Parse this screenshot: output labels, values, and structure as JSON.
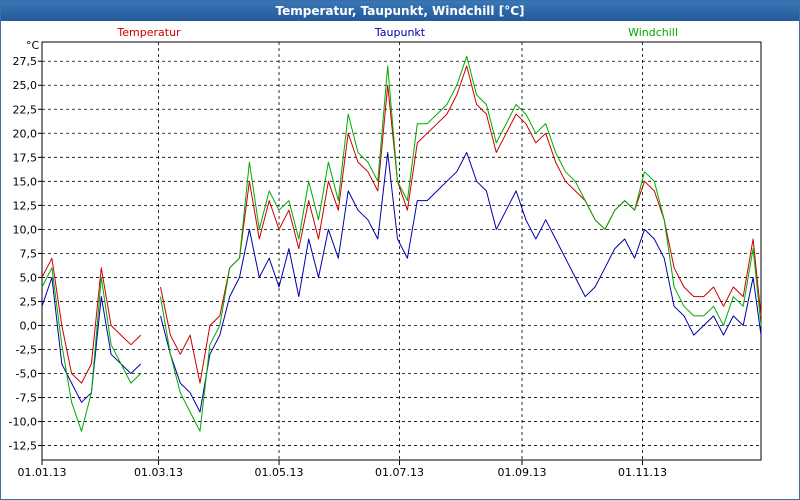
{
  "window": {
    "title": "Temperatur, Taupunkt, Windchill [°C]"
  },
  "chart_data": {
    "type": "line",
    "title": "Temperatur, Taupunkt, Windchill [°C]",
    "yunit": "°C",
    "ylim": [
      -14,
      29.5
    ],
    "yticks": [
      "27,5",
      "25,0",
      "22,5",
      "20,0",
      "17,5",
      "15,0",
      "12,5",
      "10,0",
      "7,5",
      "5,0",
      "2,5",
      "0,0",
      "-2,5",
      "-5,0",
      "-7,5",
      "-10,0",
      "-12,5"
    ],
    "xlim": [
      "2013-01-01",
      "2013-12-31"
    ],
    "xticks": [
      {
        "date": "2013-01-01",
        "label": "01.01.13"
      },
      {
        "date": "2013-03-01",
        "label": "01.03.13"
      },
      {
        "date": "2013-05-01",
        "label": "01.05.13"
      },
      {
        "date": "2013-07-01",
        "label": "01.07.13"
      },
      {
        "date": "2013-09-01",
        "label": "01.09.13"
      },
      {
        "date": "2013-11-01",
        "label": "01.11.13"
      }
    ],
    "grid": true,
    "legend_position": "top",
    "x": [
      "2013-01-01",
      "2013-01-06",
      "2013-01-11",
      "2013-01-16",
      "2013-01-21",
      "2013-01-26",
      "2013-01-31",
      "2013-02-05",
      "2013-02-10",
      "2013-02-15",
      "2013-02-20",
      "2013-02-25",
      "2013-03-02",
      "2013-03-07",
      "2013-03-12",
      "2013-03-17",
      "2013-03-22",
      "2013-03-27",
      "2013-04-01",
      "2013-04-06",
      "2013-04-11",
      "2013-04-16",
      "2013-04-21",
      "2013-04-26",
      "2013-05-01",
      "2013-05-06",
      "2013-05-11",
      "2013-05-16",
      "2013-05-21",
      "2013-05-26",
      "2013-05-31",
      "2013-06-05",
      "2013-06-10",
      "2013-06-15",
      "2013-06-20",
      "2013-06-25",
      "2013-06-30",
      "2013-07-05",
      "2013-07-10",
      "2013-07-15",
      "2013-07-20",
      "2013-07-25",
      "2013-07-30",
      "2013-08-04",
      "2013-08-09",
      "2013-08-14",
      "2013-08-19",
      "2013-08-24",
      "2013-08-29",
      "2013-09-03",
      "2013-09-08",
      "2013-09-13",
      "2013-09-18",
      "2013-09-23",
      "2013-09-28",
      "2013-10-03",
      "2013-10-08",
      "2013-10-13",
      "2013-10-18",
      "2013-10-23",
      "2013-10-28",
      "2013-11-02",
      "2013-11-07",
      "2013-11-12",
      "2013-11-17",
      "2013-11-22",
      "2013-11-27",
      "2013-12-02",
      "2013-12-07",
      "2013-12-12",
      "2013-12-17",
      "2013-12-22",
      "2013-12-27",
      "2013-12-31"
    ],
    "series": [
      {
        "name": "Temperatur",
        "color": "#cc0000",
        "values": [
          5,
          7,
          0,
          -5,
          -6,
          -4,
          6,
          0,
          -1,
          -2,
          -1,
          null,
          4,
          -1,
          -3,
          -1,
          -6,
          0,
          1,
          6,
          7,
          15,
          9,
          13,
          10,
          12,
          8,
          13,
          9,
          15,
          12,
          20,
          17,
          16,
          14,
          25,
          15,
          12,
          19,
          20,
          21,
          22,
          24,
          27,
          23,
          22,
          18,
          20,
          22,
          21,
          19,
          20,
          17,
          15,
          14,
          13,
          11,
          10,
          12,
          13,
          12,
          15,
          14,
          11,
          6,
          4,
          3,
          3,
          4,
          2,
          4,
          3,
          9,
          1
        ]
      },
      {
        "name": "Taupunkt",
        "color": "#0000aa",
        "values": [
          2,
          5,
          -4,
          -6,
          -8,
          -7,
          3,
          -3,
          -4,
          -5,
          -4,
          null,
          1,
          -3,
          -6,
          -7,
          -9,
          -3,
          -1,
          3,
          5,
          10,
          5,
          7,
          4,
          8,
          3,
          9,
          5,
          10,
          7,
          14,
          12,
          11,
          9,
          18,
          9,
          7,
          13,
          13,
          14,
          15,
          16,
          18,
          15,
          14,
          10,
          12,
          14,
          11,
          9,
          11,
          9,
          7,
          5,
          3,
          4,
          6,
          8,
          9,
          7,
          10,
          9,
          7,
          2,
          1,
          -1,
          0,
          1,
          -1,
          1,
          0,
          5,
          -1
        ]
      },
      {
        "name": "Windchill",
        "color": "#00aa00",
        "values": [
          4,
          6,
          -2,
          -8,
          -11,
          -7,
          5,
          -2,
          -4,
          -6,
          -5,
          null,
          3,
          -3,
          -7,
          -9,
          -11,
          -2,
          0,
          6,
          7,
          17,
          10,
          14,
          12,
          13,
          9,
          15,
          11,
          17,
          13,
          22,
          18,
          17,
          15,
          27,
          15,
          13,
          21,
          21,
          22,
          23,
          25,
          28,
          24,
          23,
          19,
          21,
          23,
          22,
          20,
          21,
          18,
          16,
          15,
          13,
          11,
          10,
          12,
          13,
          12,
          16,
          15,
          11,
          4,
          2,
          1,
          1,
          2,
          0,
          3,
          2,
          8,
          0
        ]
      }
    ]
  }
}
